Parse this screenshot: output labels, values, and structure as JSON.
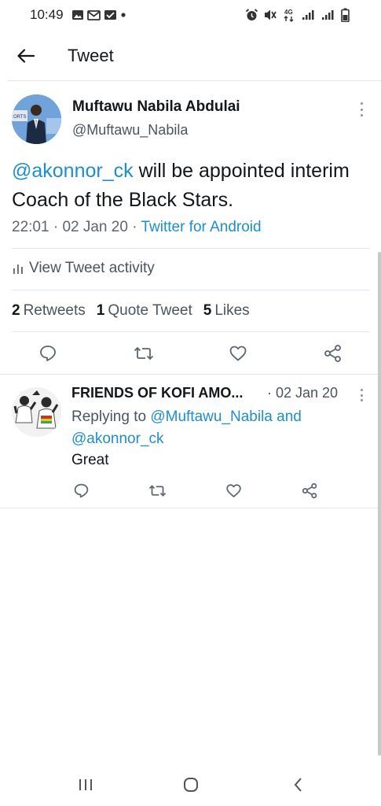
{
  "status_bar": {
    "time": "10:49",
    "network": "4G",
    "left_icons": [
      "gallery-icon",
      "gmail-icon",
      "message-icon",
      "dot-icon"
    ],
    "right_icons": [
      "alarm-icon",
      "mute-icon",
      "network-icon",
      "signal-icon",
      "signal-icon",
      "battery-icon"
    ]
  },
  "header": {
    "title": "Tweet",
    "back_icon": "arrow-left-icon"
  },
  "tweet": {
    "author_name": "Muftawu Nabila Abdulai",
    "author_handle": "@Muftawu_Nabila",
    "text_mention": "@akonnor_ck",
    "text_body": " will be appointed interim Coach of the Black Stars.",
    "time": "22:01",
    "date": "02 Jan 20",
    "separator": "·",
    "source": "Twitter for Android",
    "activity_label": "View Tweet activity",
    "retweets_count": "2",
    "retweets_label": "Retweets",
    "quote_count": "1",
    "quote_label": "Quote Tweet",
    "likes_count": "5",
    "likes_label": "Likes"
  },
  "reply": {
    "author_name": "FRIENDS OF KOFI AMO...",
    "date": "· 02 Jan 20",
    "replying_prefix": "Replying to ",
    "replying_mention_1": "@Muftawu_Nabila",
    "replying_and": " and",
    "replying_mention_2": "@akonnor_ck",
    "text": "Great"
  },
  "colors": {
    "accent": "#1b8fd4",
    "text": "#14171a",
    "muted": "#4a5561",
    "icon": "#5b6670",
    "divider": "#e1e8ed"
  }
}
